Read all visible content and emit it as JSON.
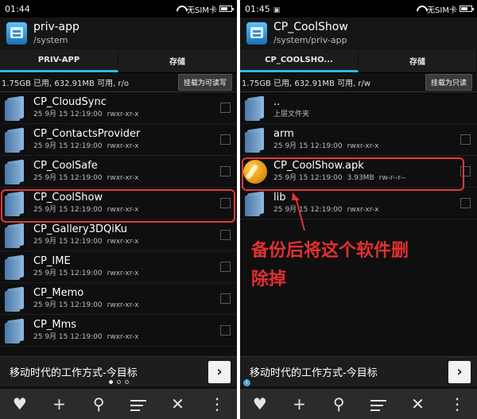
{
  "left": {
    "status": {
      "time": "01:44",
      "sim": "无SIM卡"
    },
    "app": {
      "title": "priv-app",
      "path": "/system"
    },
    "tabs": [
      "PRIV-APP",
      "存储"
    ],
    "info": {
      "text": "1.75GB 已用, 632.91MB 可用, r/o",
      "button": "挂载为可读写"
    },
    "files": [
      {
        "name": "CP_CloudSync",
        "date": "25 9月 15 12:19:00",
        "perm": "rwxr-xr-x"
      },
      {
        "name": "CP_ContactsProvider",
        "date": "25 9月 15 12:19:00",
        "perm": "rwxr-xr-x"
      },
      {
        "name": "CP_CoolSafe",
        "date": "25 9月 15 12:19:00",
        "perm": "rwxr-xr-x"
      },
      {
        "name": "CP_CoolShow",
        "date": "25 9月 15 12:19:00",
        "perm": "rwxr-xr-x"
      },
      {
        "name": "CP_Gallery3DQiKu",
        "date": "25 9月 15 12:19:00",
        "perm": "rwxr-xr-x"
      },
      {
        "name": "CP_IME",
        "date": "25 9月 15 12:19:00",
        "perm": "rwxr-xr-x"
      },
      {
        "name": "CP_Memo",
        "date": "25 9月 15 12:19:00",
        "perm": "rwxr-xr-x"
      },
      {
        "name": "CP_Mms",
        "date": "25 9月 15 12:19:00",
        "perm": "rwxr-xr-x"
      }
    ],
    "ad": {
      "text": "移动时代的工作方式-今目标",
      "arrow": "›"
    }
  },
  "right": {
    "status": {
      "time": "01:45",
      "sim": "无SIM卡"
    },
    "app": {
      "title": "CP_CoolShow",
      "path": "/system/priv-app"
    },
    "tabs": [
      "CP_COOLSHO...",
      "存储"
    ],
    "info": {
      "text": "1.75GB 已用, 632.91MB 可用, r/w",
      "button": "挂载为只读"
    },
    "parent": {
      "name": "..",
      "label": "上层文件夹"
    },
    "files": [
      {
        "name": "arm",
        "date": "25 9月 15 12:19:00",
        "size": "",
        "perm": "rwxr-xr-x"
      },
      {
        "name": "CP_CoolShow.apk",
        "date": "25 9月 15 12:19:00",
        "size": "3.93MB",
        "perm": "rw-r--r--"
      },
      {
        "name": "lib",
        "date": "25 9月 15 12:19:00",
        "size": "",
        "perm": "rwxr-xr-x"
      }
    ],
    "ad": {
      "text": "移动时代的工作方式-今目标",
      "arrow": "›",
      "info": "i"
    }
  },
  "bottombar": {
    "heart": "♥",
    "plus": "+",
    "search": "⚲",
    "close": "✕",
    "more": "⋮"
  },
  "annotation": {
    "line1": "备份后将这个软件删",
    "line2": "除掉"
  },
  "colors": {
    "accent": "#33b5e5",
    "highlight": "#e33b3b"
  }
}
